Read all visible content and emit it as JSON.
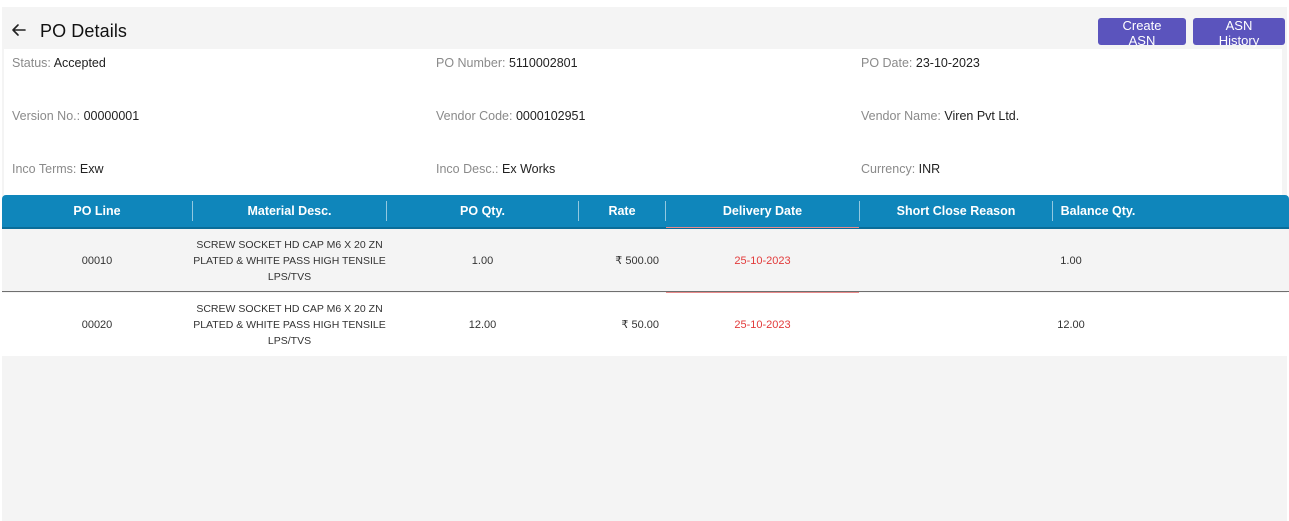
{
  "header": {
    "title": "PO Details",
    "create_asn_label": "Create ASN",
    "asn_history_label": "ASN History"
  },
  "details": {
    "status": {
      "label": "Status:",
      "value": "Accepted"
    },
    "po_number": {
      "label": "PO Number:",
      "value": "5110002801"
    },
    "po_date": {
      "label": "PO Date:",
      "value": "23-10-2023"
    },
    "version_no": {
      "label": "Version No.:",
      "value": "00000001"
    },
    "vendor_code": {
      "label": "Vendor Code:",
      "value": "0000102951"
    },
    "vendor_name": {
      "label": "Vendor Name:",
      "value": "Viren Pvt Ltd."
    },
    "inco_terms": {
      "label": "Inco Terms:",
      "value": "Exw"
    },
    "inco_desc": {
      "label": "Inco Desc.:",
      "value": "Ex Works"
    },
    "currency": {
      "label": "Currency:",
      "value": "INR"
    }
  },
  "table": {
    "columns": [
      "PO Line",
      "Material Desc.",
      "PO Qty.",
      "Rate",
      "Delivery Date",
      "Short Close Reason",
      "Balance Qty."
    ],
    "rows": [
      {
        "po_line": "00010",
        "desc_lines": [
          "SCREW SOCKET HD CAP M6 X 20 ZN",
          "PLATED & WHITE PASS HIGH TENSILE",
          "LPS/TVS"
        ],
        "po_qty": "1.00",
        "rate": "₹ 500.00",
        "delivery_date": "25-10-2023",
        "short_close_reason": "",
        "balance_qty": "1.00"
      },
      {
        "po_line": "00020",
        "desc_lines": [
          "SCREW SOCKET HD CAP M6 X 20 ZN",
          "PLATED & WHITE PASS HIGH TENSILE",
          "LPS/TVS"
        ],
        "po_qty": "12.00",
        "rate": "₹ 50.00",
        "delivery_date": "25-10-2023",
        "short_close_reason": "",
        "balance_qty": "12.00"
      }
    ]
  },
  "colors": {
    "button": "#5b54bd",
    "table_header": "#0f86bb",
    "date_text": "#e23b3b"
  },
  "icons": {
    "back": "arrow-left-icon"
  }
}
